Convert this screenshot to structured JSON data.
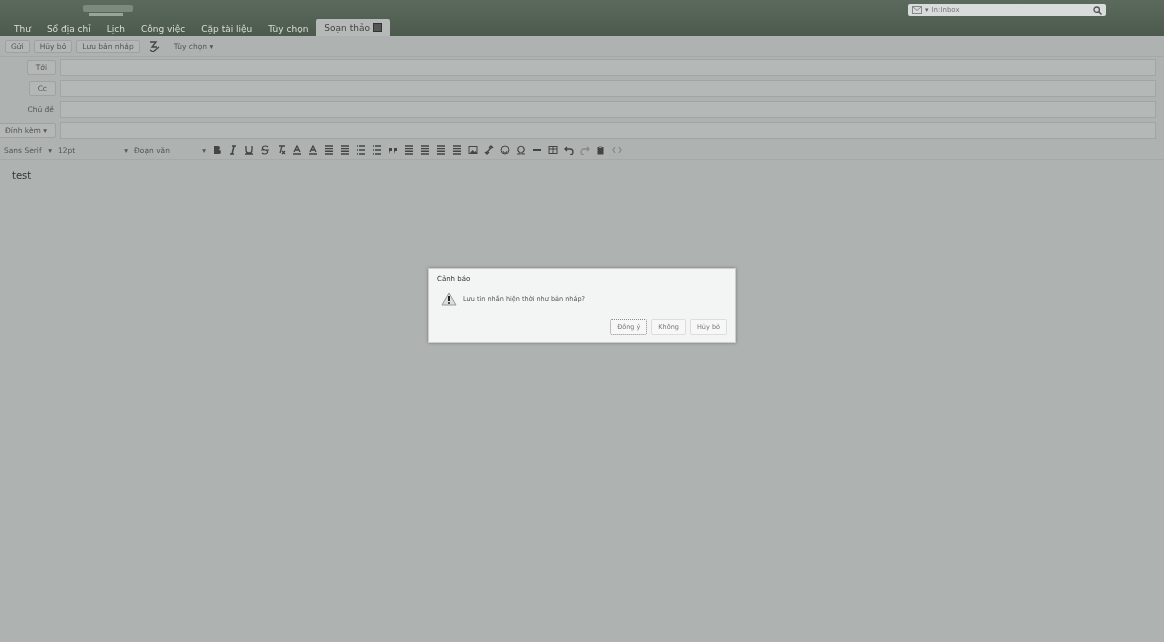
{
  "search": {
    "placeholder": "In:Inbox",
    "scope_caret": "▾"
  },
  "tabs": [
    {
      "label": "Thư",
      "selected": false
    },
    {
      "label": "Sổ địa chỉ",
      "selected": false
    },
    {
      "label": "Lịch",
      "selected": false
    },
    {
      "label": "Công việc",
      "selected": false
    },
    {
      "label": "Cặp tài liệu",
      "selected": false
    },
    {
      "label": "Tùy chọn",
      "selected": false
    },
    {
      "label": "Soạn thảo",
      "selected": true,
      "closable": true
    }
  ],
  "toolbar": [
    {
      "kind": "button",
      "label": "Gửi"
    },
    {
      "kind": "button",
      "label": "Hủy bỏ"
    },
    {
      "kind": "button",
      "label": "Lưu bản nháp"
    },
    {
      "kind": "icon"
    },
    {
      "kind": "menu",
      "label": "Tùy chọn",
      "caret": "▾"
    }
  ],
  "fields": [
    {
      "kind": "button",
      "label": "Tới"
    },
    {
      "kind": "button",
      "label": "Cc"
    },
    {
      "kind": "label",
      "label": "Chủ đề"
    },
    {
      "kind": "menu",
      "label": "Đính kèm",
      "caret": "▾"
    }
  ],
  "format": {
    "font": "Sans Serif",
    "size": "12pt",
    "block": "Đoạn văn",
    "caret": "▾"
  },
  "body": "test",
  "dialog": {
    "title": "Cảnh báo",
    "message": "Lưu tin nhắn hiện thời như bản nháp?",
    "buttons": [
      {
        "label": "Đồng ý",
        "selected": true
      },
      {
        "label": "Không",
        "selected": false
      },
      {
        "label": "Hủy bỏ",
        "selected": false
      }
    ]
  }
}
